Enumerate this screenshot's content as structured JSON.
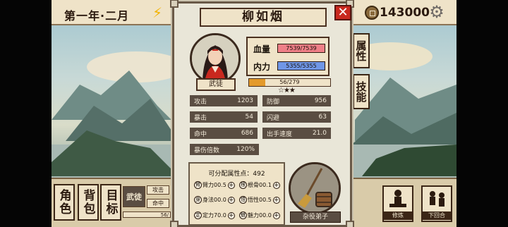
{
  "hud": {
    "date": "第一年·二月",
    "money": "143000"
  },
  "side_tabs": [
    {
      "label": "属性"
    },
    {
      "label": "技能"
    }
  ],
  "bottom_nav": [
    {
      "label": "角色"
    },
    {
      "label": "背包"
    },
    {
      "label": "目标"
    }
  ],
  "bottom_hud": {
    "rank_label": "武徒",
    "mini_attack": "攻击",
    "mini_hit": "命中",
    "mini_xp": "56/"
  },
  "actions": [
    {
      "label": "修炼"
    },
    {
      "label": "下回合"
    }
  ],
  "panel": {
    "title": "柳如烟",
    "rank": "武徒",
    "hp_label": "血量",
    "hp_value": "7539/7539",
    "mp_label": "内力",
    "mp_value": "5355/5355",
    "xp_text": "56/279",
    "xp_fraction": 0.2,
    "stars": "☆★★",
    "stats": [
      {
        "label": "攻击",
        "value": "1203"
      },
      {
        "label": "防御",
        "value": "956"
      },
      {
        "label": "暴击",
        "value": "54"
      },
      {
        "label": "闪避",
        "value": "63"
      },
      {
        "label": "命中",
        "value": "686"
      },
      {
        "label": "出手速度",
        "value": "21.0"
      },
      {
        "label": "暴伤倍数",
        "value": "120%"
      }
    ],
    "alloc_title": "可分配属性点：492",
    "attributes": [
      {
        "icon": "臂",
        "label": "臂力",
        "value": "00.5"
      },
      {
        "icon": "根",
        "label": "根骨",
        "value": "00.1"
      },
      {
        "icon": "身",
        "label": "身法",
        "value": "00.0"
      },
      {
        "icon": "悟",
        "label": "悟性",
        "value": "00.5"
      },
      {
        "icon": "定",
        "label": "定力",
        "value": "70.0"
      },
      {
        "icon": "魅",
        "label": "魅力",
        "value": "00.0"
      }
    ],
    "role_label": "杂役弟子"
  },
  "colors": {
    "hp_bar": "#ef7f87",
    "mp_bar": "#6f96e6",
    "xp_fill": "#e39a2c",
    "close_red": "#c9281e"
  }
}
